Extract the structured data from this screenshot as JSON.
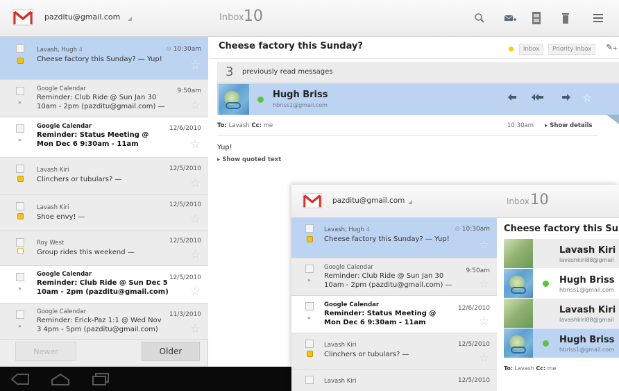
{
  "main": {
    "account": "pazditu@gmail.com",
    "folder_label": "Inbox",
    "folder_count": "10",
    "toolbar_icons": [
      "search-icon",
      "compose-icon",
      "archive-icon",
      "delete-icon",
      "menu-icon"
    ],
    "messages": [
      {
        "sender": "Lavash, Hugh",
        "count": "4",
        "subject": "Cheese factory this Sunday? — Yup!",
        "date": "10:30am",
        "state": "selected",
        "attachment": true
      },
      {
        "sender": "Google Calendar",
        "subject_l1": "Reminder: Club Ride @ Sun Jan 30",
        "subject_l2": "10am - 2pm (pazditu@gmail.com) —",
        "date": "9:50am",
        "state": "read"
      },
      {
        "sender": "Google Calendar",
        "subject_l1": "Reminder: Status Meeting @",
        "subject_l2": "Mon Dec 6 9:30am - 11am",
        "date": "12/6/2010",
        "state": "unread"
      },
      {
        "sender": "Lavash Kiri",
        "subject": "Clinchers or tubulars? —",
        "date": "12/5/2010",
        "state": "read"
      },
      {
        "sender": "Lavash Kiri",
        "subject": "Shoe envy! —",
        "date": "12/5/2010",
        "state": "read"
      },
      {
        "sender": "Roy West",
        "subject": "Group rides this weekend —",
        "date": "12/5/2010",
        "state": "read"
      },
      {
        "sender": "Google Calendar",
        "subject_l1": "Reminder: Club Ride @ Sun Dec 5",
        "subject_l2": "10am - 2pm (pazditu@gmail.com)",
        "date": "12/5/2010",
        "state": "unread"
      },
      {
        "sender": "Google Calendar",
        "subject_l1": "Reminder: Erick-Paz 1:1 @ Wed Nov",
        "subject_l2": "3 4pm - 5pm (pazditu@gmail.com)",
        "date": "11/3/2010",
        "state": "read"
      }
    ],
    "newer_label": "Newer",
    "older_label": "Older",
    "conversation": {
      "subject": "Cheese factory this Sunday?",
      "labels": [
        "Inbox",
        "Priority Inbox"
      ],
      "previously_read_count": "3",
      "previously_read_text": "previously read messages",
      "from_name": "Hugh Briss",
      "from_email": "hbriss1@gmail.com",
      "to_label": "To:",
      "to_value": "Lavash",
      "cc_label": "Cc:",
      "cc_value": "me",
      "time": "10:30am",
      "show_details": "▸ Show details",
      "body": "Yup!",
      "show_quoted": "▸ Show quoted text"
    }
  },
  "overlay": {
    "account": "pazditu@gmail.com",
    "folder_label": "Inbox",
    "folder_count": "10",
    "messages": [
      {
        "sender": "Lavash, Hugh",
        "count": "4",
        "subject": "Cheese factory this Sunday? — Yup!",
        "date": "10:30am"
      },
      {
        "sender": "Google Calendar",
        "subject_l1": "Reminder: Club Ride @ Sun Jan 30",
        "subject_l2": "10am - 2pm (pazditu@gmail.com) —",
        "date": "9:50am"
      },
      {
        "sender": "Google Calendar",
        "subject_l1": "Reminder: Status Meeting @",
        "subject_l2": "Mon Dec 6 9:30am - 11am",
        "date": "12/6/2010"
      },
      {
        "sender": "Lavash Kiri",
        "subject": "Clinchers or tubulars? —",
        "date": "12/5/2010"
      },
      {
        "sender": "Lavash Kiri",
        "subject": "",
        "date": "12/5/2010"
      }
    ],
    "conversation_title": "Cheese factory this Su",
    "thread": [
      {
        "name": "Lavash Kiri",
        "email": "lavashkiri88@gmail"
      },
      {
        "name": "Hugh Briss",
        "email": "hbriss1@gmail.com"
      },
      {
        "name": "Lavash Kiri",
        "email": "lavashkiri88@gmail"
      },
      {
        "name": "Hugh Briss",
        "email": "hbriss1@gmail.com"
      }
    ],
    "to_label": "To:",
    "to_value": "Lavash",
    "cc_label": "Cc:",
    "cc_value": "me"
  },
  "colors": {
    "selected_row": "#bcd3f2",
    "gmail_red": "#d93025",
    "important_yellow": "#f0c419",
    "online_green": "#5ec240"
  }
}
